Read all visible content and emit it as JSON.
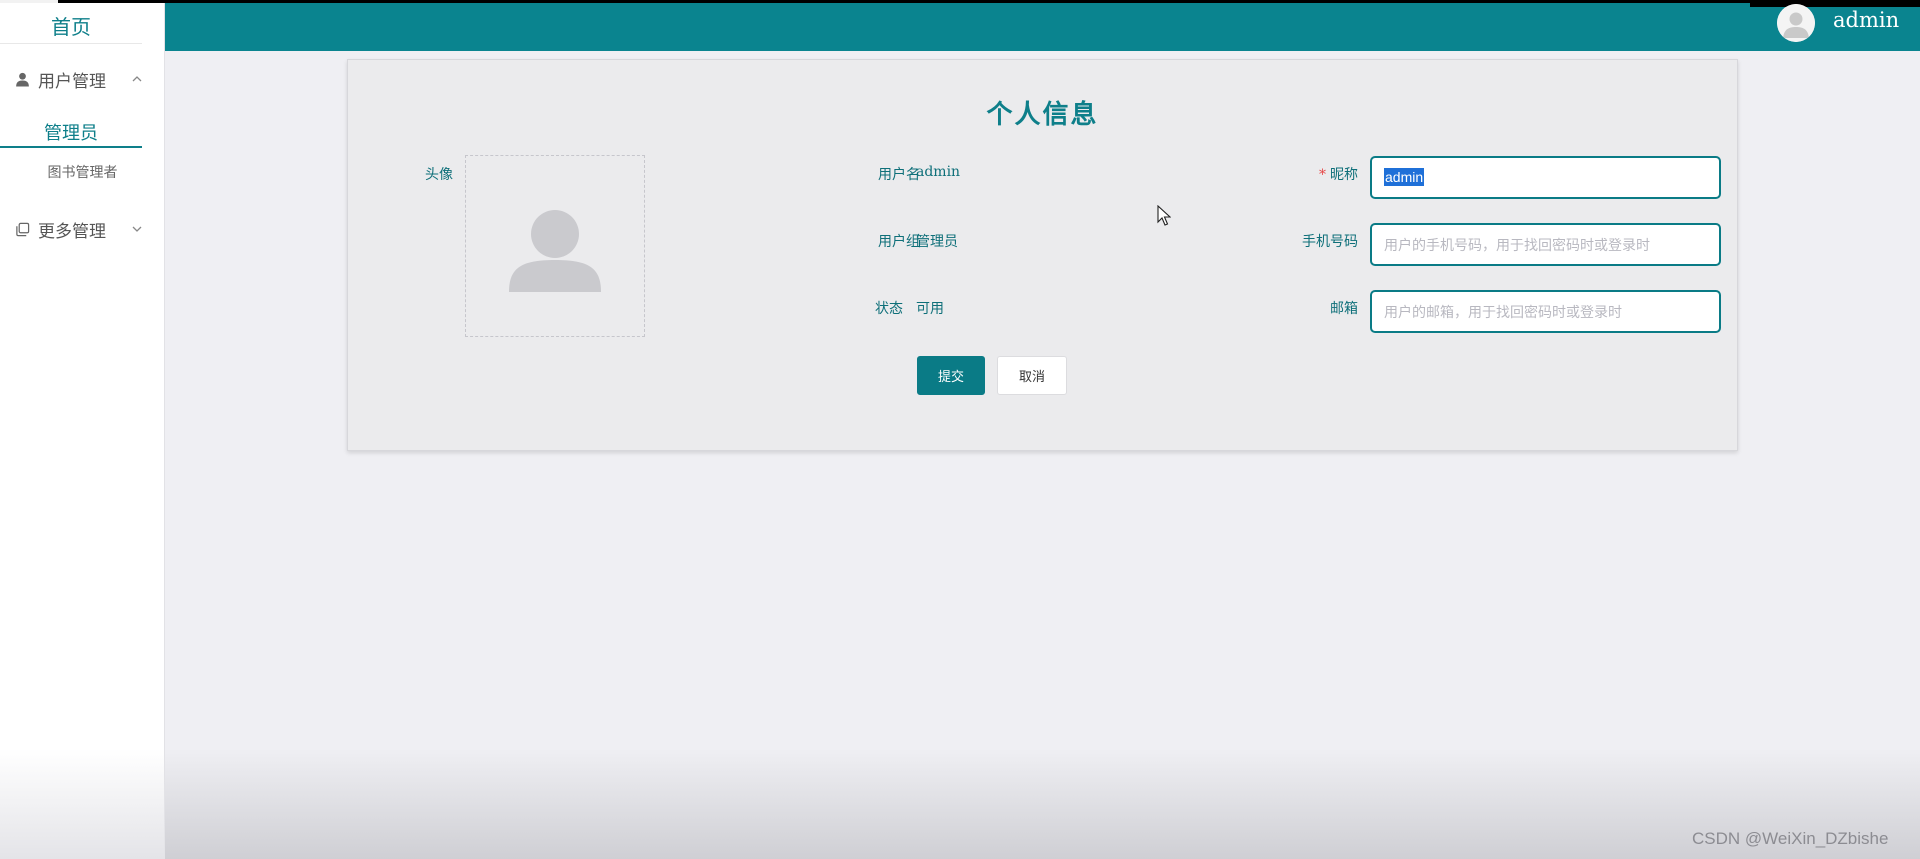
{
  "sidebar": {
    "home": "首页",
    "groups": [
      {
        "label": "用户管理",
        "icon": "user-icon",
        "expanded": true,
        "items": [
          {
            "label": "管理员",
            "active": true
          },
          {
            "label": "图书管理者",
            "active": false
          }
        ]
      },
      {
        "label": "更多管理",
        "icon": "copy-icon",
        "expanded": false,
        "items": []
      }
    ]
  },
  "header": {
    "username": "admin",
    "avatar_icon": "avatar-icon"
  },
  "profile": {
    "title": "个人信息",
    "avatar_label": "头像",
    "username_label": "用户名",
    "username_value": "admin",
    "group_label": "用户组",
    "group_value": "管理员",
    "status_label": "状态",
    "status_value": "可用",
    "nickname_required_mark": "*",
    "nickname_label": "昵称",
    "nickname_value": "admin",
    "phone_label": "手机号码",
    "phone_placeholder": "用户的手机号码，用于找回密码时或登录时",
    "email_label": "邮箱",
    "email_placeholder": "用户的邮箱，用于找回密码时或登录时",
    "submit_label": "提交",
    "cancel_label": "取消"
  },
  "watermark": "CSDN @WeiXin_DZbishe",
  "colors": {
    "accent": "#0a848f",
    "sidebar_bg": "#ffffff",
    "page_bg": "#efeff3",
    "card_bg": "#ebebed",
    "required": "#e64545"
  }
}
